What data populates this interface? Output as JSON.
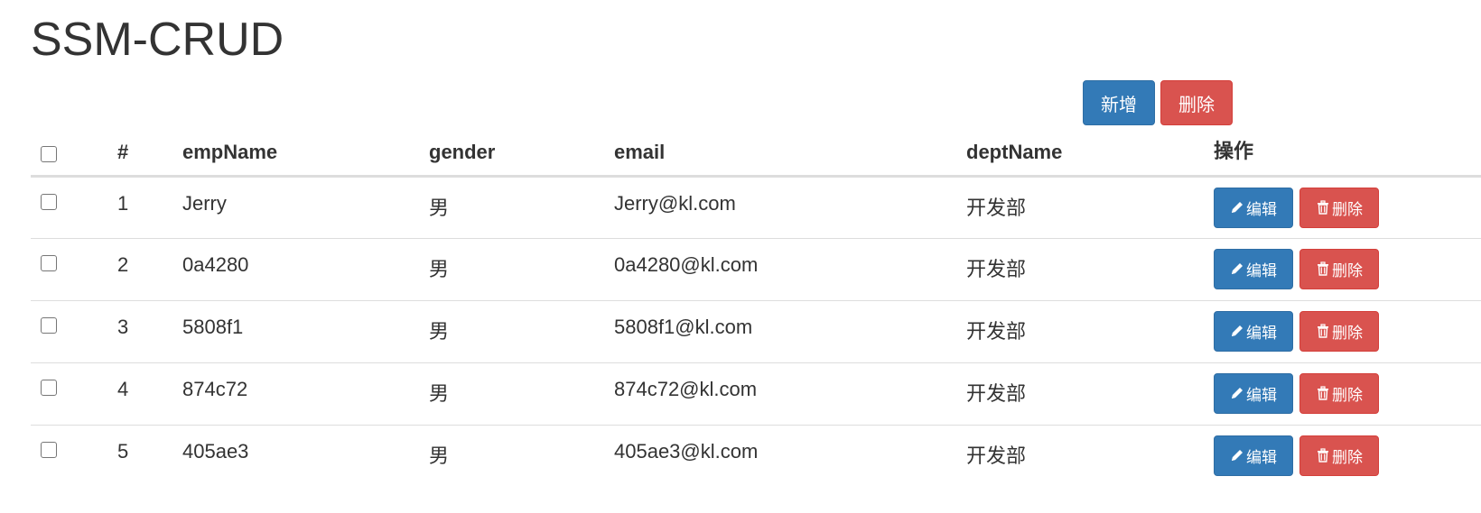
{
  "page": {
    "title": "SSM-CRUD"
  },
  "toolbar": {
    "add_label": "新增",
    "delete_label": "删除"
  },
  "table": {
    "headers": {
      "id": "#",
      "emp_name": "empName",
      "gender": "gender",
      "email": "email",
      "dept_name": "deptName",
      "ops": "操作"
    },
    "rows": [
      {
        "id": "1",
        "emp_name": "Jerry",
        "gender": "男",
        "email": "Jerry@kl.com",
        "dept_name": "开发部",
        "edit_label": "编辑",
        "delete_label": "删除"
      },
      {
        "id": "2",
        "emp_name": "0a4280",
        "gender": "男",
        "email": "0a4280@kl.com",
        "dept_name": "开发部",
        "edit_label": "编辑",
        "delete_label": "删除"
      },
      {
        "id": "3",
        "emp_name": "5808f1",
        "gender": "男",
        "email": "5808f1@kl.com",
        "dept_name": "开发部",
        "edit_label": "编辑",
        "delete_label": "删除"
      },
      {
        "id": "4",
        "emp_name": "874c72",
        "gender": "男",
        "email": "874c72@kl.com",
        "dept_name": "开发部",
        "edit_label": "编辑",
        "delete_label": "删除"
      },
      {
        "id": "5",
        "emp_name": "405ae3",
        "gender": "男",
        "email": "405ae3@kl.com",
        "dept_name": "开发部",
        "edit_label": "编辑",
        "delete_label": "删除"
      }
    ]
  },
  "colors": {
    "primary": "#337ab7",
    "danger": "#d9534f",
    "text": "#333333",
    "border": "#dddddd"
  },
  "icons": {
    "edit": "pencil-icon",
    "delete": "trash-icon"
  }
}
